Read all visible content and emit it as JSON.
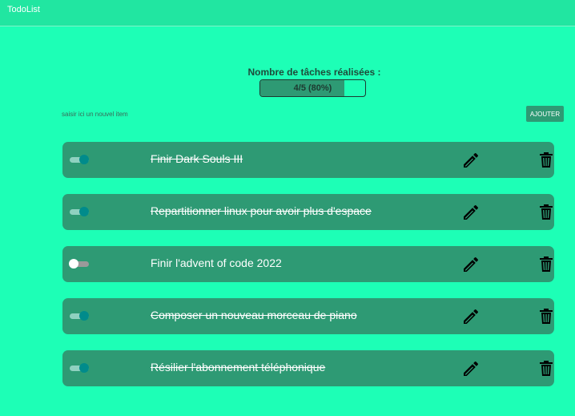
{
  "header": {
    "title": "TodoList"
  },
  "progress": {
    "label": "Nombre de tâches réalisées :",
    "text": "4/5 (80%)",
    "fraction": 0.8
  },
  "new_item": {
    "placeholder": "saisir ici un nouvel item",
    "value": ""
  },
  "add_button": {
    "label": "AJOUTER"
  },
  "todos": [
    {
      "label": "Finir Dark Souls III",
      "done": true
    },
    {
      "label": "Repartitionner linux pour avoir plus d'espace",
      "done": true
    },
    {
      "label": "Finir l'advent of code 2022",
      "done": false
    },
    {
      "label": "Composer un nouveau morceau de piano",
      "done": true
    },
    {
      "label": "Résilier l'abonnement téléphonique",
      "done": true
    }
  ],
  "icons": {
    "edit": "pencil-icon",
    "delete": "trash-icon"
  },
  "colors": {
    "background": "#1dffb6",
    "header": "#21e6a1",
    "row": "#2e9a74",
    "toggle_on": "#008b8b"
  }
}
